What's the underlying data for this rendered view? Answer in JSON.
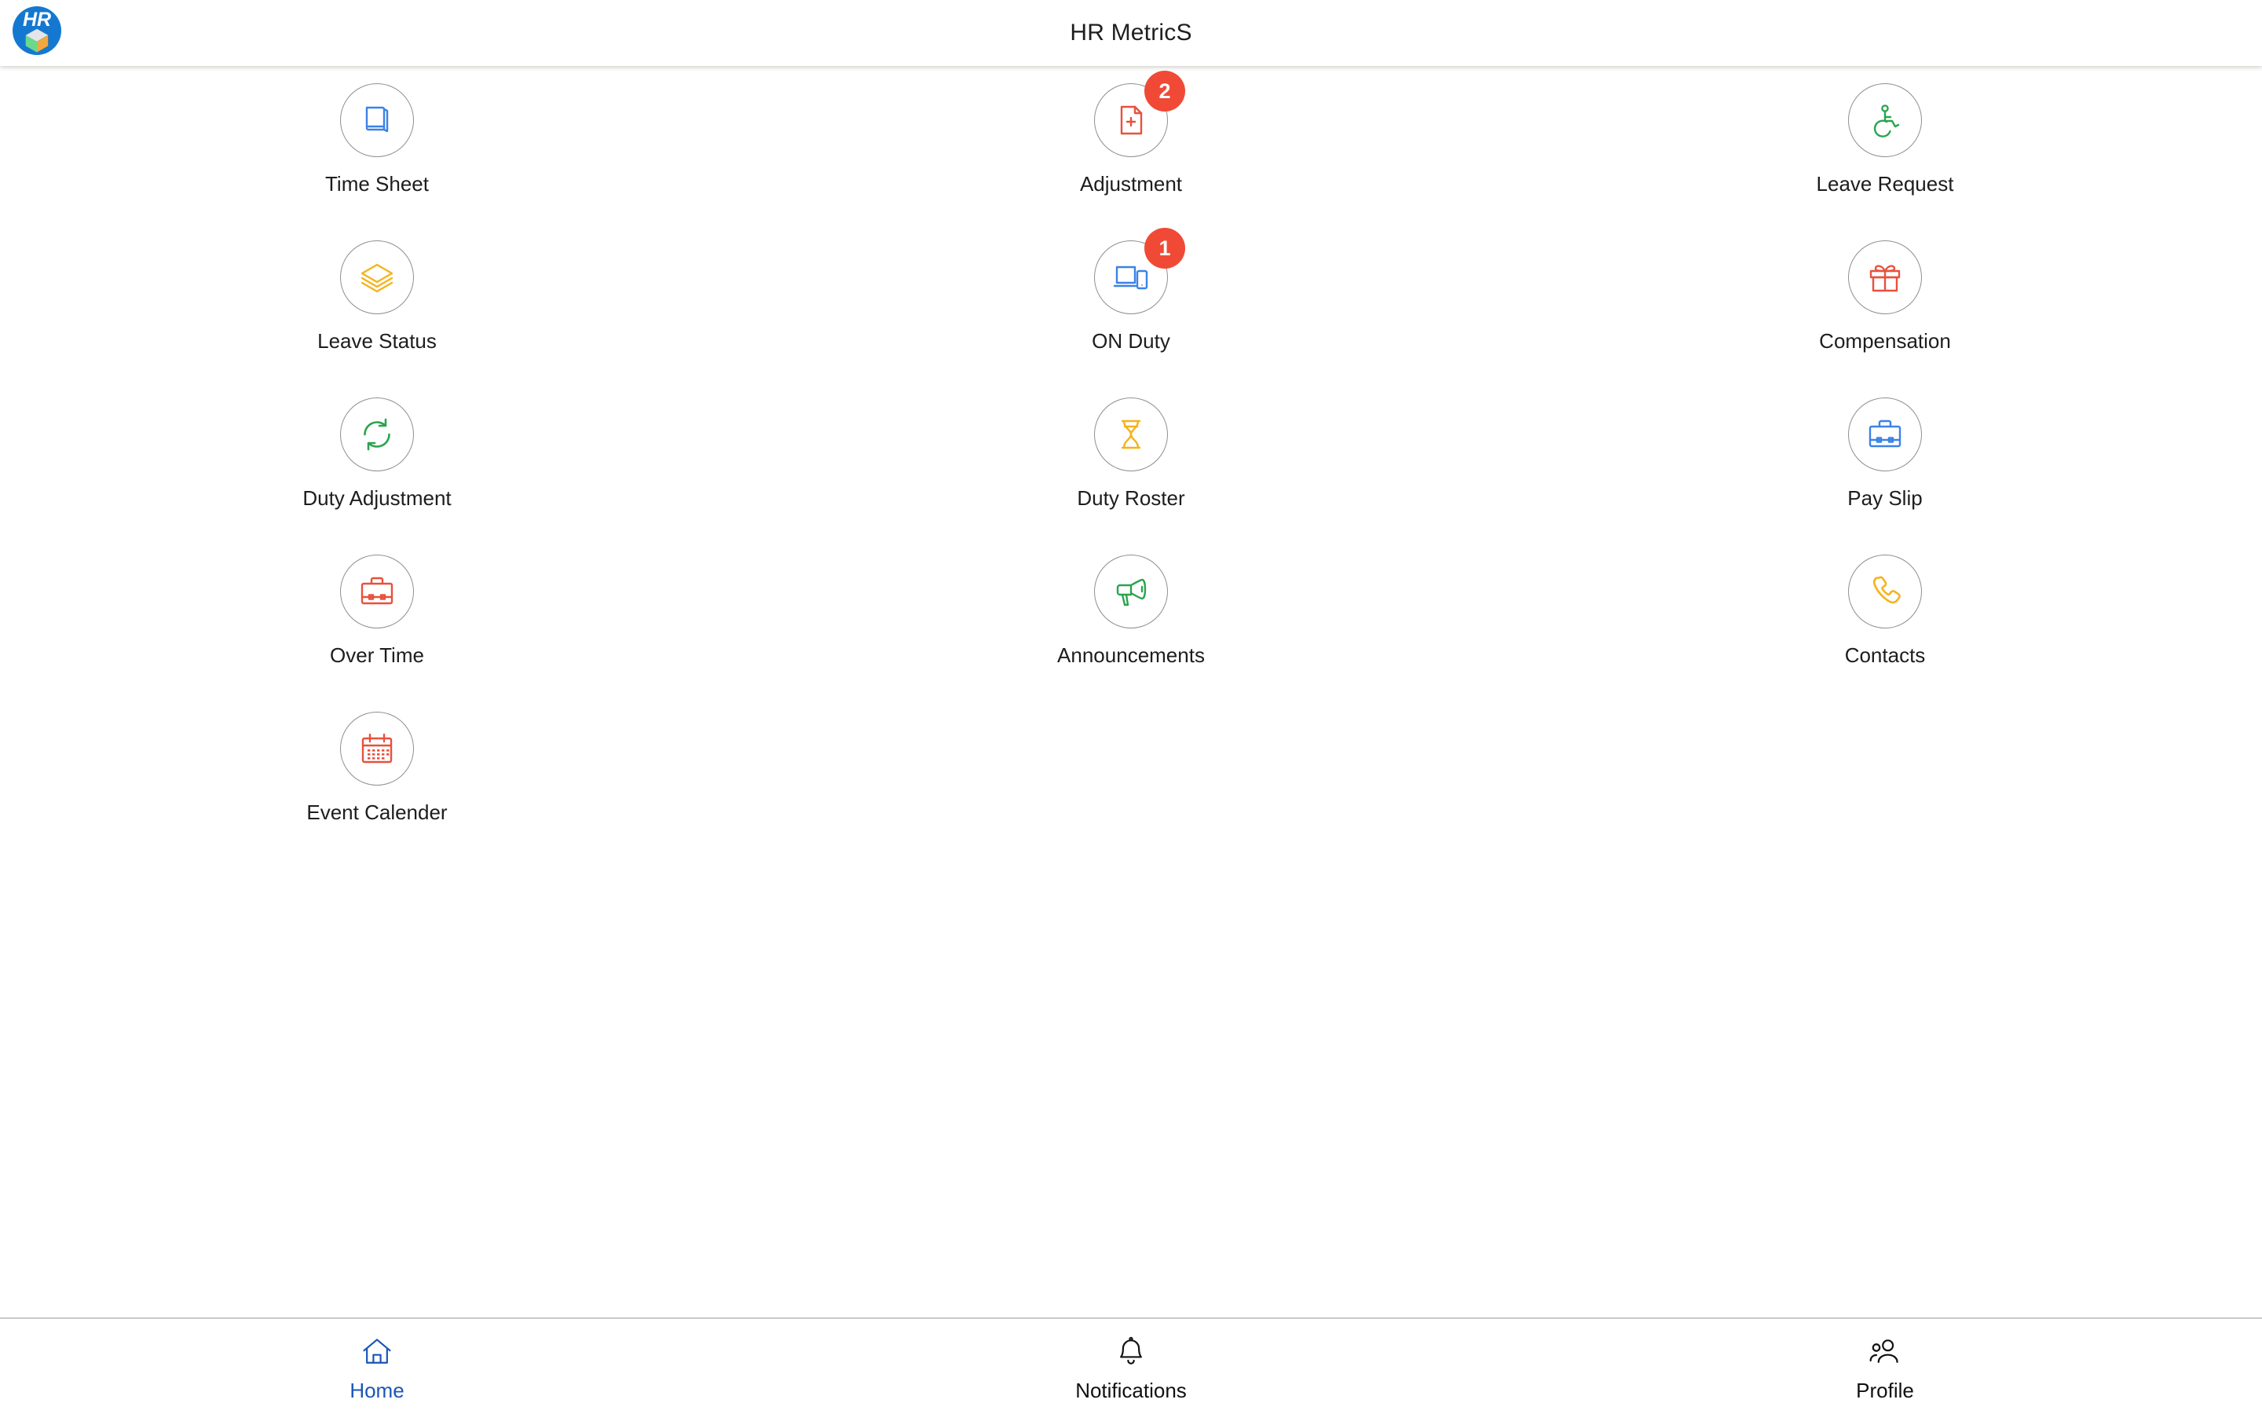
{
  "header": {
    "title": "HR MetricS",
    "logo": {
      "text": "HR",
      "icon": "hr-cube-logo",
      "bg_color": "#1578d0"
    }
  },
  "colors": {
    "blue": "#3b82e8",
    "red": "#e8513c",
    "green": "#2aa44f",
    "amber": "#f5b31b",
    "badge": "#f04a36",
    "active_nav": "#1a56b5",
    "circle_border": "#8f8f8f"
  },
  "grid": {
    "tiles": [
      {
        "label": "Time Sheet",
        "icon": "book-icon",
        "color": "#3b82e8",
        "badge": null
      },
      {
        "label": "Adjustment",
        "icon": "document-plus-icon",
        "color": "#e8513c",
        "badge": "2"
      },
      {
        "label": "Leave Request",
        "icon": "wheelchair-icon",
        "color": "#2aa44f",
        "badge": null
      },
      {
        "label": "Leave Status",
        "icon": "layers-icon",
        "color": "#f5b31b",
        "badge": null
      },
      {
        "label": "ON Duty",
        "icon": "devices-icon",
        "color": "#3b82e8",
        "badge": "1"
      },
      {
        "label": "Compensation",
        "icon": "gift-icon",
        "color": "#e8513c",
        "badge": null
      },
      {
        "label": "Duty Adjustment",
        "icon": "refresh-icon",
        "color": "#2aa44f",
        "badge": null
      },
      {
        "label": "Duty Roster",
        "icon": "hourglass-icon",
        "color": "#f5b31b",
        "badge": null
      },
      {
        "label": "Pay Slip",
        "icon": "briefcase-icon",
        "color": "#3b82e8",
        "badge": null
      },
      {
        "label": "Over Time",
        "icon": "briefcase-icon",
        "color": "#e8513c",
        "badge": null
      },
      {
        "label": "Announcements",
        "icon": "megaphone-icon",
        "color": "#2aa44f",
        "badge": null
      },
      {
        "label": "Contacts",
        "icon": "phone-icon",
        "color": "#f5b31b",
        "badge": null
      },
      {
        "label": "Event Calender",
        "icon": "calendar-icon",
        "color": "#e8513c",
        "badge": null
      }
    ]
  },
  "bottom_nav": {
    "items": [
      {
        "label": "Home",
        "icon": "home-icon",
        "active": true
      },
      {
        "label": "Notifications",
        "icon": "bell-icon",
        "active": false
      },
      {
        "label": "Profile",
        "icon": "people-icon",
        "active": false
      }
    ]
  }
}
